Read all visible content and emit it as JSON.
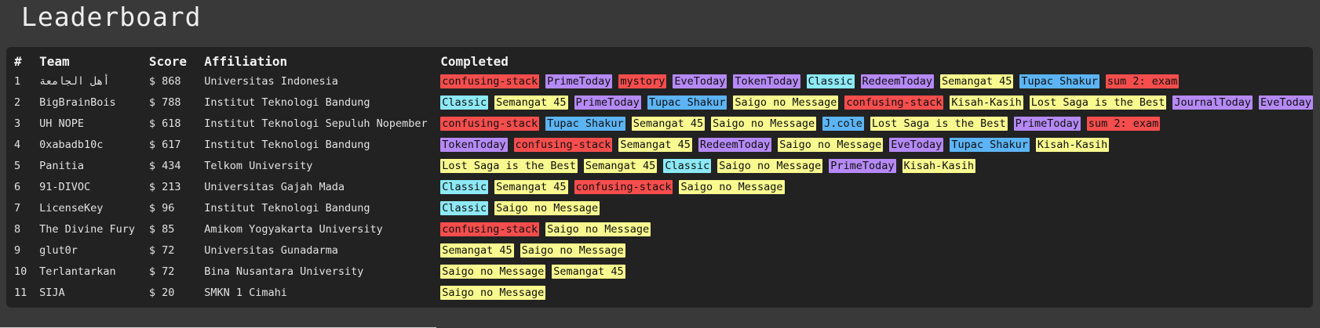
{
  "page": {
    "title": "Leaderboard"
  },
  "columns": {
    "rank": "#",
    "team": "Team",
    "score": "Score",
    "affiliation": "Affiliation",
    "completed": "Completed"
  },
  "tag_colors": {
    "red": "#f64d4d",
    "purple": "#b589f6",
    "cyan": "#8ce9f5",
    "yellow": "#f8f98f",
    "blue": "#5cb4f5"
  },
  "rows": [
    {
      "rank": "1",
      "team": "أهل الجامعة",
      "score": "$ 868",
      "affiliation": "Universitas Indonesia",
      "completed": [
        {
          "label": "confusing-stack",
          "color": "red"
        },
        {
          "label": "PrimeToday",
          "color": "purple"
        },
        {
          "label": "mystory",
          "color": "red"
        },
        {
          "label": "EveToday",
          "color": "purple"
        },
        {
          "label": "TokenToday",
          "color": "purple"
        },
        {
          "label": "Classic",
          "color": "cyan"
        },
        {
          "label": "RedeemToday",
          "color": "purple"
        },
        {
          "label": "Semangat 45",
          "color": "yellow"
        },
        {
          "label": "Tupac Shakur",
          "color": "blue"
        },
        {
          "label": "sum 2: exam",
          "color": "red"
        }
      ]
    },
    {
      "rank": "2",
      "team": "BigBrainBois",
      "score": "$ 788",
      "affiliation": "Institut Teknologi Bandung",
      "completed": [
        {
          "label": "Classic",
          "color": "cyan"
        },
        {
          "label": "Semangat 45",
          "color": "yellow"
        },
        {
          "label": "PrimeToday",
          "color": "purple"
        },
        {
          "label": "Tupac Shakur",
          "color": "blue"
        },
        {
          "label": "Saigo no Message",
          "color": "yellow"
        },
        {
          "label": "confusing-stack",
          "color": "red"
        },
        {
          "label": "Kisah-Kasih",
          "color": "yellow"
        },
        {
          "label": "Lost Saga is the Best",
          "color": "yellow"
        },
        {
          "label": "JournalToday",
          "color": "purple"
        },
        {
          "label": "EveToday",
          "color": "purple"
        }
      ]
    },
    {
      "rank": "3",
      "team": "UH NOPE",
      "score": "$ 618",
      "affiliation": "Institut Teknologi Sepuluh Nopember",
      "completed": [
        {
          "label": "confusing-stack",
          "color": "red"
        },
        {
          "label": "Tupac Shakur",
          "color": "blue"
        },
        {
          "label": "Semangat 45",
          "color": "yellow"
        },
        {
          "label": "Saigo no Message",
          "color": "yellow"
        },
        {
          "label": "J.cole",
          "color": "blue"
        },
        {
          "label": "Lost Saga is the Best",
          "color": "yellow"
        },
        {
          "label": "PrimeToday",
          "color": "purple"
        },
        {
          "label": "sum 2: exam",
          "color": "red"
        }
      ]
    },
    {
      "rank": "4",
      "team": "0xabadb10c",
      "score": "$ 617",
      "affiliation": "Institut Teknologi Bandung",
      "completed": [
        {
          "label": "TokenToday",
          "color": "purple"
        },
        {
          "label": "confusing-stack",
          "color": "red"
        },
        {
          "label": "Semangat 45",
          "color": "yellow"
        },
        {
          "label": "RedeemToday",
          "color": "purple"
        },
        {
          "label": "Saigo no Message",
          "color": "yellow"
        },
        {
          "label": "EveToday",
          "color": "purple"
        },
        {
          "label": "Tupac Shakur",
          "color": "blue"
        },
        {
          "label": "Kisah-Kasih",
          "color": "yellow"
        }
      ]
    },
    {
      "rank": "5",
      "team": "Panitia",
      "score": "$ 434",
      "affiliation": "Telkom University",
      "completed": [
        {
          "label": "Lost Saga is the Best",
          "color": "yellow"
        },
        {
          "label": "Semangat 45",
          "color": "yellow"
        },
        {
          "label": "Classic",
          "color": "cyan"
        },
        {
          "label": "Saigo no Message",
          "color": "yellow"
        },
        {
          "label": "PrimeToday",
          "color": "purple"
        },
        {
          "label": "Kisah-Kasih",
          "color": "yellow"
        }
      ]
    },
    {
      "rank": "6",
      "team": "91-DIVOC",
      "score": "$ 213",
      "affiliation": "Universitas Gajah Mada",
      "completed": [
        {
          "label": "Classic",
          "color": "cyan"
        },
        {
          "label": "Semangat 45",
          "color": "yellow"
        },
        {
          "label": "confusing-stack",
          "color": "red"
        },
        {
          "label": "Saigo no Message",
          "color": "yellow"
        }
      ]
    },
    {
      "rank": "7",
      "team": "LicenseKey",
      "score": "$ 96",
      "affiliation": "Institut Teknologi Bandung",
      "completed": [
        {
          "label": "Classic",
          "color": "cyan"
        },
        {
          "label": "Saigo no Message",
          "color": "yellow"
        }
      ]
    },
    {
      "rank": "8",
      "team": "The Divine Fury",
      "score": "$ 85",
      "affiliation": "Amikom Yogyakarta University",
      "completed": [
        {
          "label": "confusing-stack",
          "color": "red"
        },
        {
          "label": "Saigo no Message",
          "color": "yellow"
        }
      ]
    },
    {
      "rank": "9",
      "team": "glut0r",
      "score": "$ 72",
      "affiliation": "Universitas Gunadarma",
      "completed": [
        {
          "label": "Semangat 45",
          "color": "yellow"
        },
        {
          "label": "Saigo no Message",
          "color": "yellow"
        }
      ]
    },
    {
      "rank": "10",
      "team": "Terlantarkan",
      "score": "$ 72",
      "affiliation": "Bina Nusantara University",
      "completed": [
        {
          "label": "Saigo no Message",
          "color": "yellow"
        },
        {
          "label": "Semangat 45",
          "color": "yellow"
        }
      ]
    },
    {
      "rank": "11",
      "team": "SIJA",
      "score": "$ 20",
      "affiliation": "SMKN 1 Cimahi",
      "completed": [
        {
          "label": "Saigo no Message",
          "color": "yellow"
        }
      ]
    }
  ]
}
